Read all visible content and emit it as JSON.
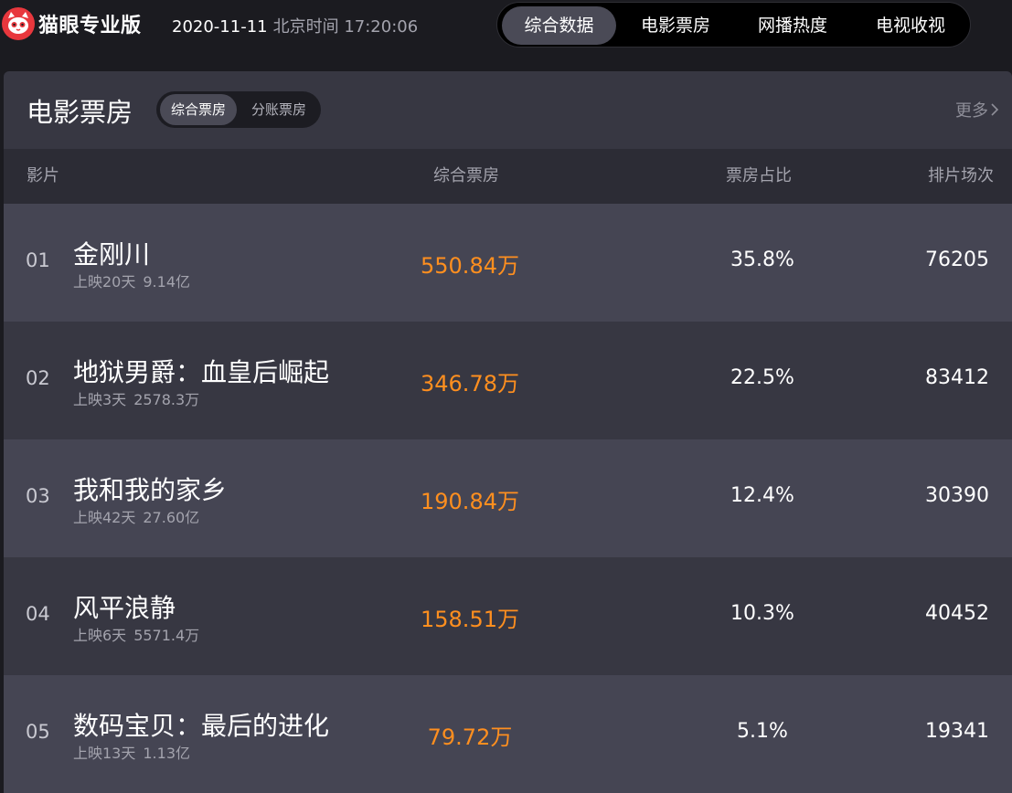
{
  "header": {
    "logo_text": "猫眼专业版",
    "date": "2020-11-11",
    "time_label": "北京时间 17:20:06",
    "nav": [
      {
        "label": "综合数据",
        "active": true
      },
      {
        "label": "电影票房",
        "active": false
      },
      {
        "label": "网播热度",
        "active": false
      },
      {
        "label": "电视收视",
        "active": false
      }
    ]
  },
  "panel": {
    "title": "电影票房",
    "toggle": [
      {
        "label": "综合票房",
        "active": true
      },
      {
        "label": "分账票房",
        "active": false
      }
    ],
    "more_label": "更多",
    "columns": {
      "film": "影片",
      "box_office": "综合票房",
      "share": "票房占比",
      "shows": "排片场次"
    },
    "rows": [
      {
        "rank": "01",
        "name": "金刚川",
        "days": "上映20天",
        "total": "9.14亿",
        "box_office": "550.84万",
        "share": "35.8%",
        "shows": "76205"
      },
      {
        "rank": "02",
        "name": "地狱男爵：血皇后崛起",
        "days": "上映3天",
        "total": "2578.3万",
        "box_office": "346.78万",
        "share": "22.5%",
        "shows": "83412"
      },
      {
        "rank": "03",
        "name": "我和我的家乡",
        "days": "上映42天",
        "total": "27.60亿",
        "box_office": "190.84万",
        "share": "12.4%",
        "shows": "30390"
      },
      {
        "rank": "04",
        "name": "风平浪静",
        "days": "上映6天",
        "total": "5571.4万",
        "box_office": "158.51万",
        "share": "10.3%",
        "shows": "40452"
      },
      {
        "rank": "05",
        "name": "数码宝贝：最后的进化",
        "days": "上映13天",
        "total": "1.13亿",
        "box_office": "79.72万",
        "share": "5.1%",
        "shows": "19341"
      }
    ]
  },
  "colors": {
    "accent_orange": "#ff8f1f",
    "logo_red": "#e8373d",
    "row_light": "#454553",
    "row_dark": "#373742"
  }
}
